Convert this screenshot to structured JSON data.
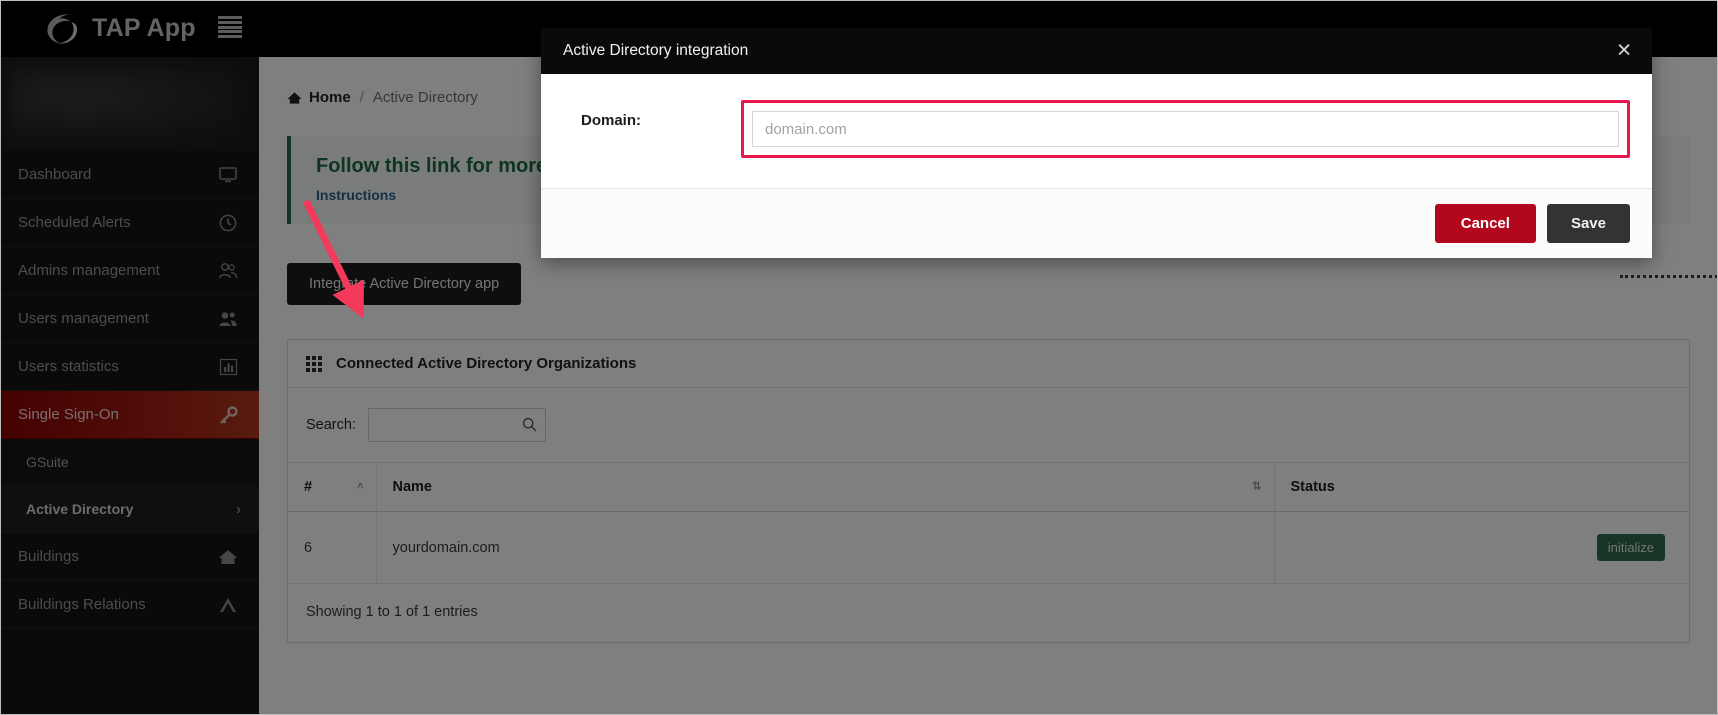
{
  "topbar": {
    "brand": "TAP App",
    "logo_icon": "swirl-logo-icon",
    "menu_icon": "hamburger-menu-icon"
  },
  "sidebar": {
    "items": [
      {
        "label": "Dashboard",
        "icon": "monitor-icon",
        "active": false
      },
      {
        "label": "Scheduled Alerts",
        "icon": "clock-icon",
        "active": false
      },
      {
        "label": "Admins management",
        "icon": "users-group-icon",
        "active": false
      },
      {
        "label": "Users management",
        "icon": "users-icon",
        "active": false
      },
      {
        "label": "Users statistics",
        "icon": "bar-chart-icon",
        "active": false
      },
      {
        "label": "Single Sign-On",
        "icon": "key-icon",
        "active": true
      },
      {
        "label": "Buildings",
        "icon": "home-icon",
        "active": false
      },
      {
        "label": "Buildings Relations",
        "icon": "relations-icon",
        "active": false
      }
    ],
    "subitems": [
      {
        "label": "GSuite",
        "active": false,
        "chevron": ""
      },
      {
        "label": "Active Directory",
        "active": true,
        "chevron": "›"
      }
    ]
  },
  "breadcrumb": {
    "home": "Home",
    "home_icon": "home-icon",
    "separator": "/",
    "current": "Active Directory"
  },
  "alert": {
    "title": "Follow this link for more info",
    "link": "Instructions"
  },
  "actions": {
    "integrate_button": "Integrate Active Directory app"
  },
  "panel": {
    "icon": "grid-icon",
    "title": "Connected Active Directory Organizations",
    "search_label": "Search:",
    "search_value": "",
    "search_placeholder": "",
    "search_icon": "search-icon",
    "columns": [
      {
        "label": "#",
        "sort": "˄"
      },
      {
        "label": "Name",
        "sort": "⇅"
      },
      {
        "label": "Status",
        "sort": ""
      }
    ],
    "rows": [
      {
        "num": "6",
        "name": "yourdomain.com",
        "status": "initialize"
      }
    ],
    "footer": "Showing 1 to 1 of 1 entries"
  },
  "modal": {
    "title": "Active Directory integration",
    "close_icon": "close-icon",
    "field_label": "Domain:",
    "field_value": "",
    "field_placeholder": "domain.com",
    "cancel_label": "Cancel",
    "save_label": "Save"
  },
  "colors": {
    "brand_dark": "#000000",
    "sidebar_bg": "#141414",
    "active_nav": "#a01d12",
    "accent_red": "#b3071d",
    "highlight_pink": "#e8174c",
    "badge_green": "#2d6a4a",
    "alert_green": "#1d6b42",
    "link_blue": "#2b5f8f"
  }
}
